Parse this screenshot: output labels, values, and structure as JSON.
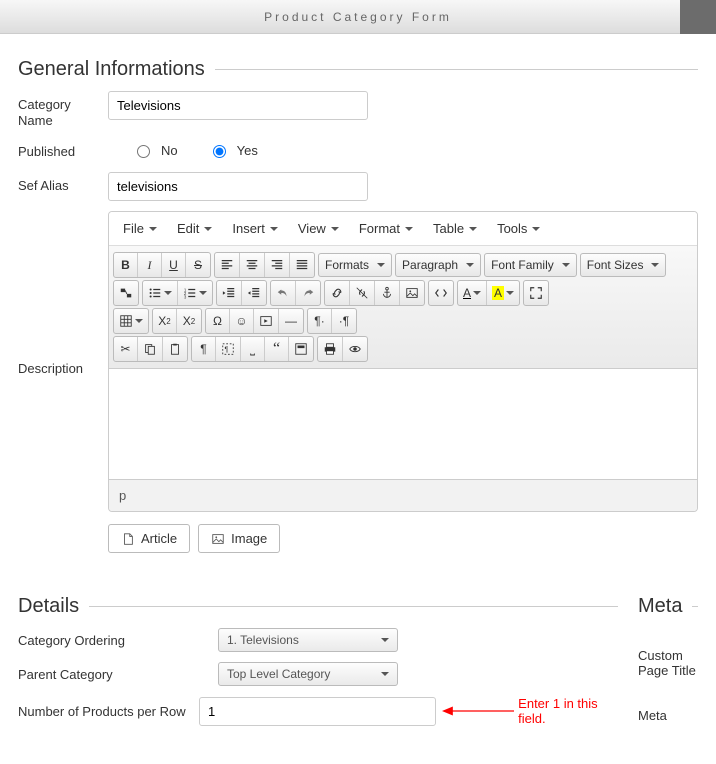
{
  "title": "Product Category Form",
  "sections": {
    "general": "General Informations",
    "details": "Details",
    "meta": "Meta"
  },
  "labels": {
    "category_name": "Category Name",
    "published": "Published",
    "sef_alias": "Sef Alias",
    "description": "Description",
    "no": "No",
    "yes": "Yes",
    "article_btn": "Article",
    "image_btn": "Image",
    "category_ordering": "Category Ordering",
    "parent_category": "Parent Category",
    "num_per_row": "Number of Products per Row",
    "custom_page_title": "Custom Page Title",
    "meta_keywords": "Meta"
  },
  "values": {
    "category_name": "Televisions",
    "published": "yes",
    "sef_alias": "televisions",
    "status_path": "p",
    "category_ordering": "1. Televisions",
    "parent_category": "Top Level Category",
    "num_per_row": "1"
  },
  "annotation": "Enter 1 in this field.",
  "editor": {
    "menus": [
      "File",
      "Edit",
      "Insert",
      "View",
      "Format",
      "Table",
      "Tools"
    ],
    "dropdowns": {
      "formats": "Formats",
      "paragraph": "Paragraph",
      "fontfamily": "Font Family",
      "fontsizes": "Font Sizes"
    }
  }
}
